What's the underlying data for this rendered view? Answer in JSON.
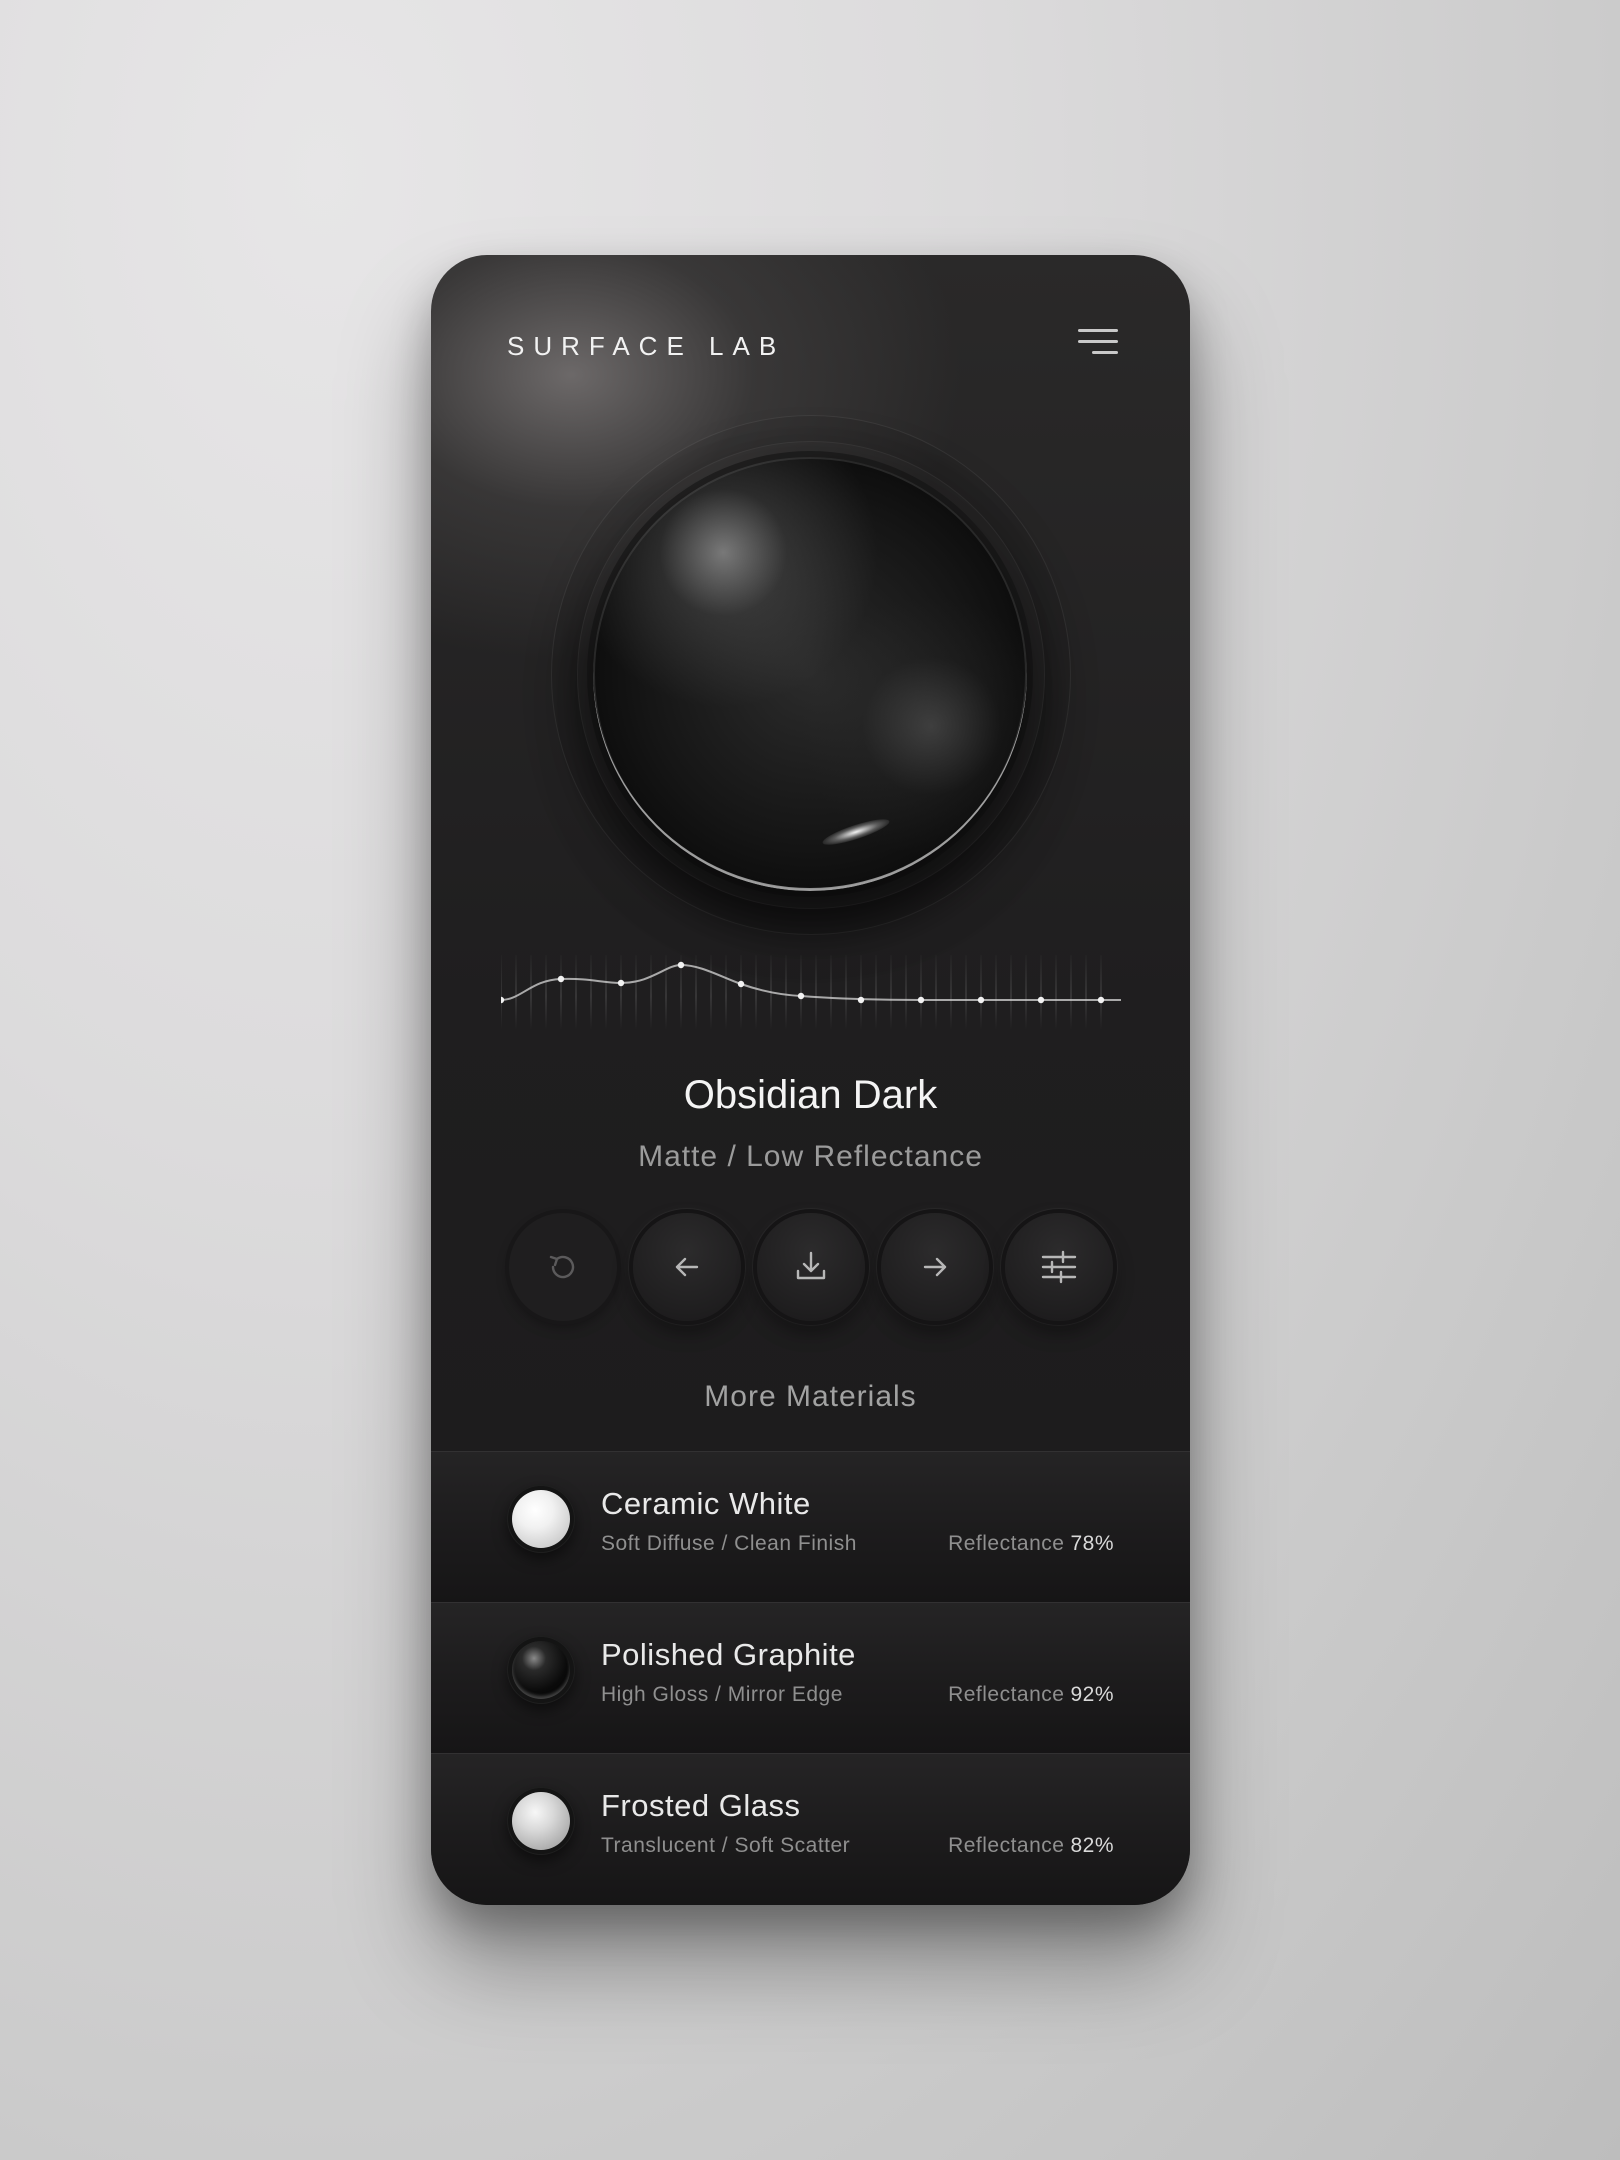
{
  "app": {
    "brand": "SURFACE LAB",
    "menu_icon": "hamburger-menu-icon"
  },
  "hero": {
    "material_name": "Obsidian Dark",
    "material_sub": "Matte / Low Reflectance"
  },
  "controls": [
    {
      "name": "reset-button",
      "icon": "reset-icon"
    },
    {
      "name": "previous-button",
      "icon": "arrow-left-icon"
    },
    {
      "name": "download-button",
      "icon": "download-icon"
    },
    {
      "name": "next-button",
      "icon": "arrow-right-icon"
    },
    {
      "name": "adjust-button",
      "icon": "sliders-icon"
    }
  ],
  "more_title": "More Materials",
  "materials": [
    {
      "name": "Ceramic White",
      "sub": "Soft Diffuse / Clean Finish",
      "refl_label": "Reflectance",
      "refl_value": "78%"
    },
    {
      "name": "Polished Graphite",
      "sub": "High Gloss / Mirror Edge",
      "refl_label": "Reflectance",
      "refl_value": "92%"
    },
    {
      "name": "Frosted Glass",
      "sub": "Translucent / Soft Scatter",
      "refl_label": "Reflectance",
      "refl_value": "82%"
    }
  ],
  "colors": {
    "card_dark": "#1f1e1f",
    "text_primary": "#f4f4f4",
    "text_muted": "#9b9b9b"
  }
}
